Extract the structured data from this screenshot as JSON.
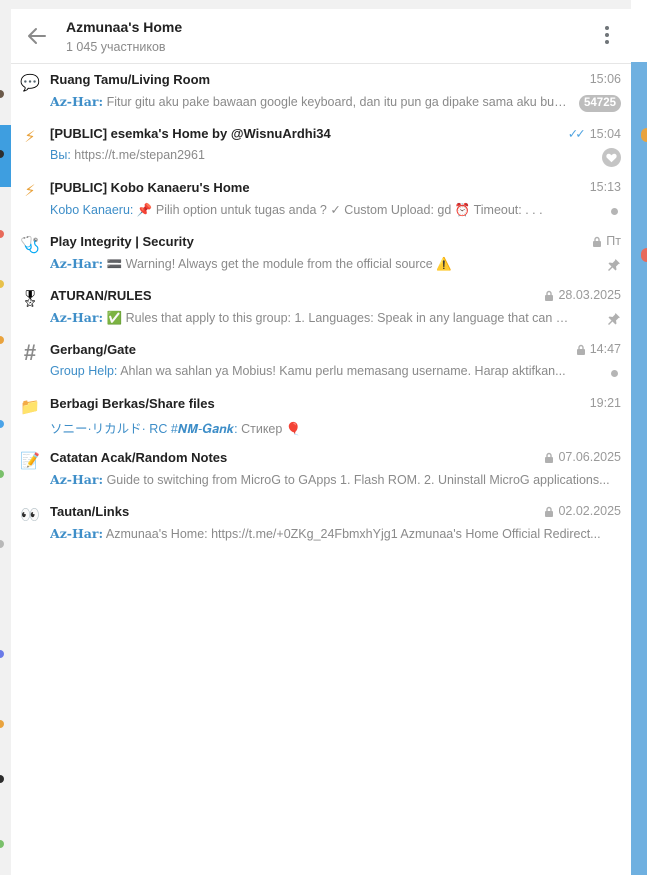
{
  "header": {
    "title": "Azmunaa's Home",
    "subtitle": "1 045 участников"
  },
  "colors": {
    "accent": "#3e8ec8",
    "badge": "#bdbdbd",
    "right_panel": "#6fb0e0",
    "selection": "#3e9ee0"
  },
  "topics": [
    {
      "icon": "speech-bubble-icon",
      "icon_glyph": "💬",
      "title": "Ruang Tamu/Living Room",
      "time": "15:06",
      "sender": "Az-Har:",
      "message": " Fitur gitu aku pake bawaan google keyboard, dan itu pun ga dipake sama aku buat teks...",
      "unread": "54725"
    },
    {
      "icon": "lightning-icon",
      "icon_glyph": "⚡",
      "title": "[PUBLIC] esemka's Home by @WisnuArdhi34",
      "time": "15:04",
      "sender": "Вы:",
      "message": " https://t.me/stepan2961",
      "read_check": "✓✓"
    },
    {
      "icon": "lightning-icon",
      "icon_glyph": "⚡",
      "title": "[PUBLIC] Kobo Kanaeru's Home",
      "time": "15:13",
      "sender": "Kobo Kanaeru:",
      "message": " 📌 Pilih option untuk tugas anda ?  ✓ Custom Upload: gd  ⏰ Timeout: . . ."
    },
    {
      "icon": "stethoscope-icon",
      "icon_glyph": "🩺",
      "title": "Play Integrity | Security",
      "time": "Пт",
      "sender": "Az-Har:",
      "message": " 🟰 Warning! Always get the module from the official source ⚠️"
    },
    {
      "icon": "medal-icon",
      "icon_glyph": "🎖",
      "title": "ATURAN/RULES",
      "time": "28.03.2025",
      "sender": "Az-Har:",
      "message": " ✅ Rules that apply to this group:  1. Languages: Speak in any language that can be understood..."
    },
    {
      "icon": "hashtag-icon",
      "icon_glyph": "#",
      "title": "Gerbang/Gate",
      "time": "14:47",
      "sender": "Group Help:",
      "message": " Ahlan wa sahlan ya Mobius! Kamu perlu memasang username. Harap aktifkan..."
    },
    {
      "icon": "folder-icon",
      "icon_glyph": "📁",
      "title": "Berbagi Berkas/Share files",
      "time": "19:21",
      "sender": "ソニー·リカルド· RC #𝑵𝑴-𝑮𝒂𝒏𝒌:",
      "message": " Стикер 🎈"
    },
    {
      "icon": "memo-icon",
      "icon_glyph": "📝",
      "title": "Catatan Acak/Random Notes",
      "time": "07.06.2025",
      "sender": "Az-Har:",
      "message": " Guide to switching from MicroG to GApps 1. Flash ROM. 2. Uninstall MicroG applications..."
    },
    {
      "icon": "eyes-icon",
      "icon_glyph": "👀",
      "title": "Tautan/Links",
      "time": "02.02.2025",
      "sender": "Az-Har:",
      "message": " Azmunaa's Home: https://t.me/+0ZKg_24FbmxhYjg1 Azmunaa's Home Official Redirect..."
    }
  ]
}
